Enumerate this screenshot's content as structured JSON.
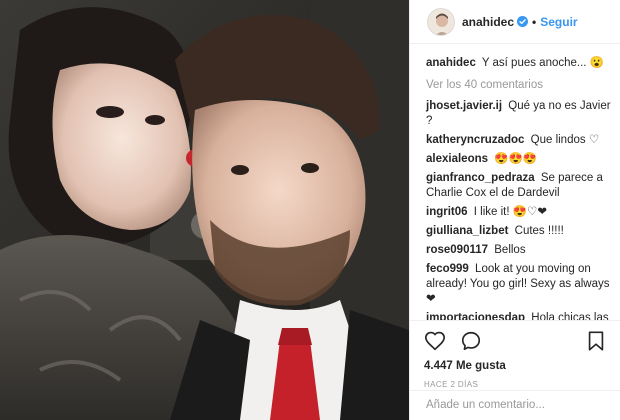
{
  "header": {
    "username": "anahidec",
    "separator": "•",
    "follow_label": "Seguir"
  },
  "caption": {
    "username": "anahidec",
    "text": "Y así pues anoche... 😮"
  },
  "view_all_label": "Ver los 40 comentarios",
  "comments": [
    {
      "user": "jhoset.javier.ij",
      "text": "Qué ya no es Javier ?"
    },
    {
      "user": "katheryncruzadoc",
      "text": "Que lindos ♡"
    },
    {
      "user": "alexialeons",
      "text": "😍😍😍"
    },
    {
      "user": "gianfranco_pedraza",
      "text": "Se parece a Charlie Cox el de Dardevil"
    },
    {
      "user": "ingrit06",
      "text": "I like it! 😍♡❤"
    },
    {
      "user": "giulliana_lizbet",
      "text": "Cutes !!!!!"
    },
    {
      "user": "rose090117",
      "text": "Bellos"
    },
    {
      "user": "feco999",
      "text": "Look at you moving on already! You go girl! Sexy as always ❤"
    },
    {
      "user": "importacionesdap",
      "text": "Hola chicas las invitamos a nuestra cuenta donde podrán encontrar lindos accesorios para hermosas como tu ♡❤"
    }
  ],
  "likes_text": "4.447 Me gusta",
  "time_text": "HACE 2 DÍAS",
  "add_comment_placeholder": "Añade un comentario...",
  "icons": {
    "like": "heart-icon",
    "comment": "comment-icon",
    "save": "bookmark-icon",
    "verified": "verified-badge-icon"
  },
  "colors": {
    "link_blue": "#3897f0",
    "text": "#262626",
    "muted": "#999999",
    "border": "#efefef"
  }
}
